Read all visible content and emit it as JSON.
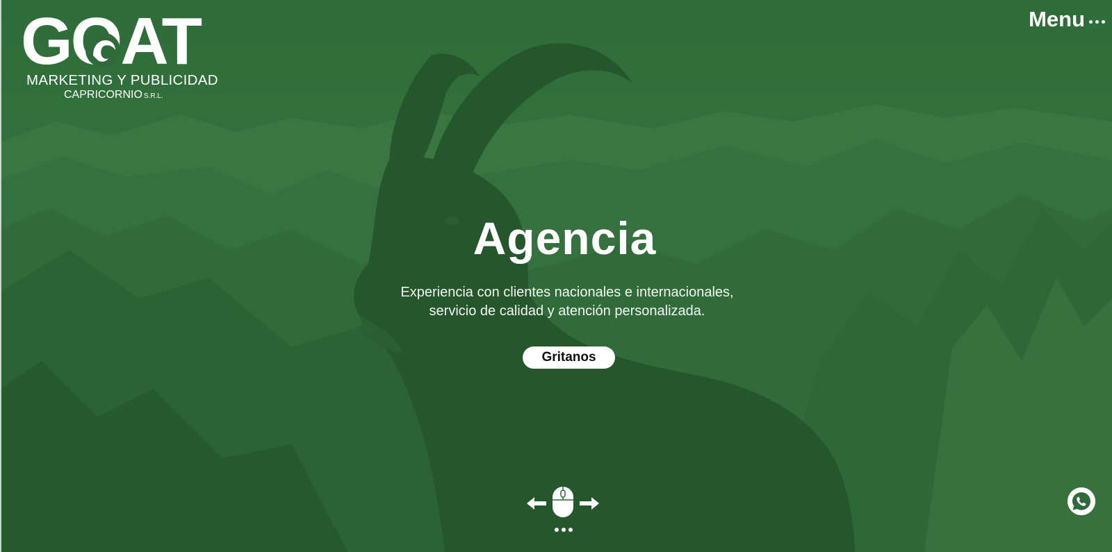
{
  "brand": {
    "wordmark": "GOAT",
    "tagline_line1": "MARKETING Y PUBLICIDAD",
    "tagline_line2": "CAPRICORNIO",
    "tagline_suffix": "S.R.L."
  },
  "nav": {
    "menu_label": "Menu",
    "menu_icon": "dots-horizontal-icon"
  },
  "hero": {
    "title": "Agencia",
    "subtitle_line1": "Experiencia con clientes nacionales e internacionales,",
    "subtitle_line2": "servicio de calidad y atención personalizada.",
    "cta_label": "Gritanos",
    "background": "ibex on mountain peaks, green tinted",
    "slide_count": 3
  },
  "scroll_hint": {
    "icons": [
      "arrow-left-icon",
      "mouse-icon",
      "arrow-right-icon"
    ]
  },
  "floating": {
    "chat_icon": "whatsapp-icon"
  },
  "colors": {
    "overlay_green": "#356b3c",
    "dark_green": "#1f4d26",
    "white": "#ffffff"
  }
}
